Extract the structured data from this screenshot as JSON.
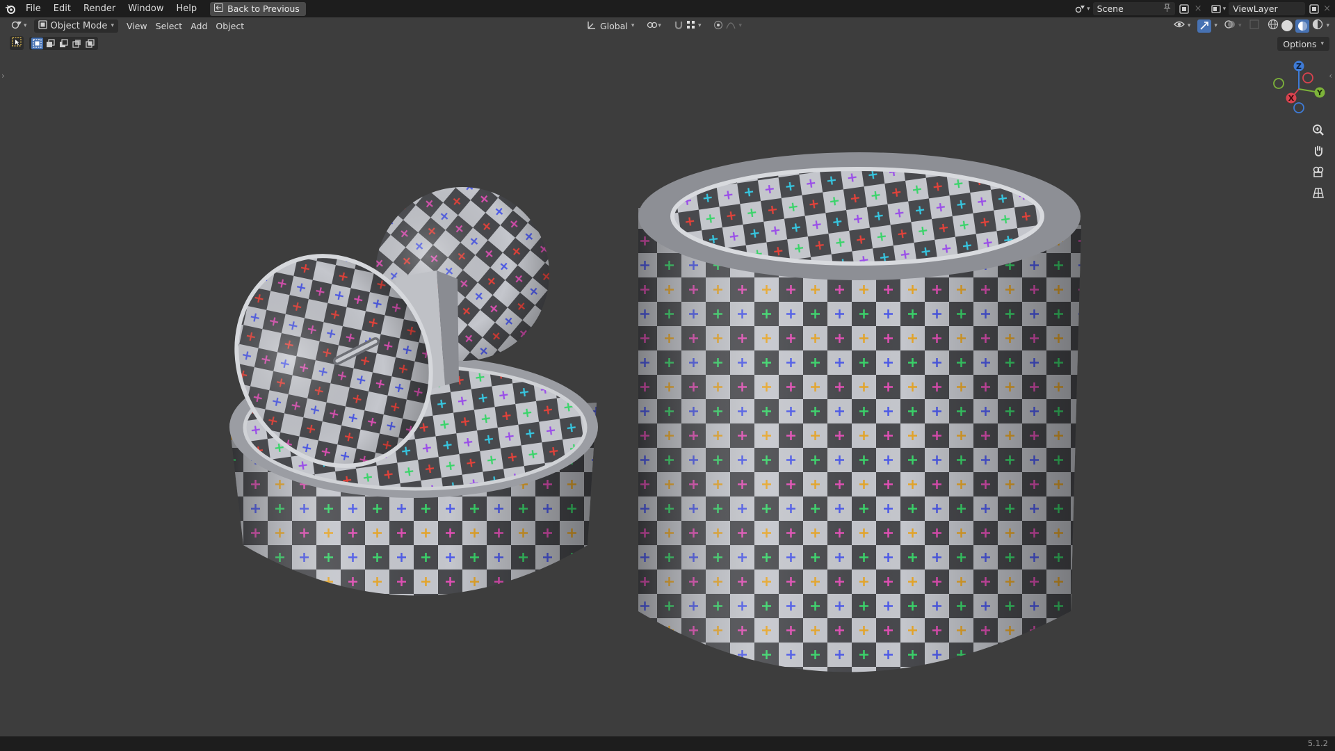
{
  "topbar": {
    "menus": [
      "File",
      "Edit",
      "Render",
      "Window",
      "Help"
    ],
    "back_label": "Back to Previous",
    "scene_label": "Scene",
    "viewlayer_label": "ViewLayer"
  },
  "header": {
    "mode_label": "Object Mode",
    "menus": [
      "View",
      "Select",
      "Add",
      "Object"
    ],
    "transform_label": "Global",
    "options_label": "Options"
  },
  "gizmo": {
    "z": "Z",
    "y": "Y",
    "x": "X"
  },
  "status": {
    "version": "5.1.2"
  },
  "colors": {
    "accent": "#4772b3",
    "checker_light": "#c8c9ce",
    "checker_dark": "#4a4b4f"
  }
}
